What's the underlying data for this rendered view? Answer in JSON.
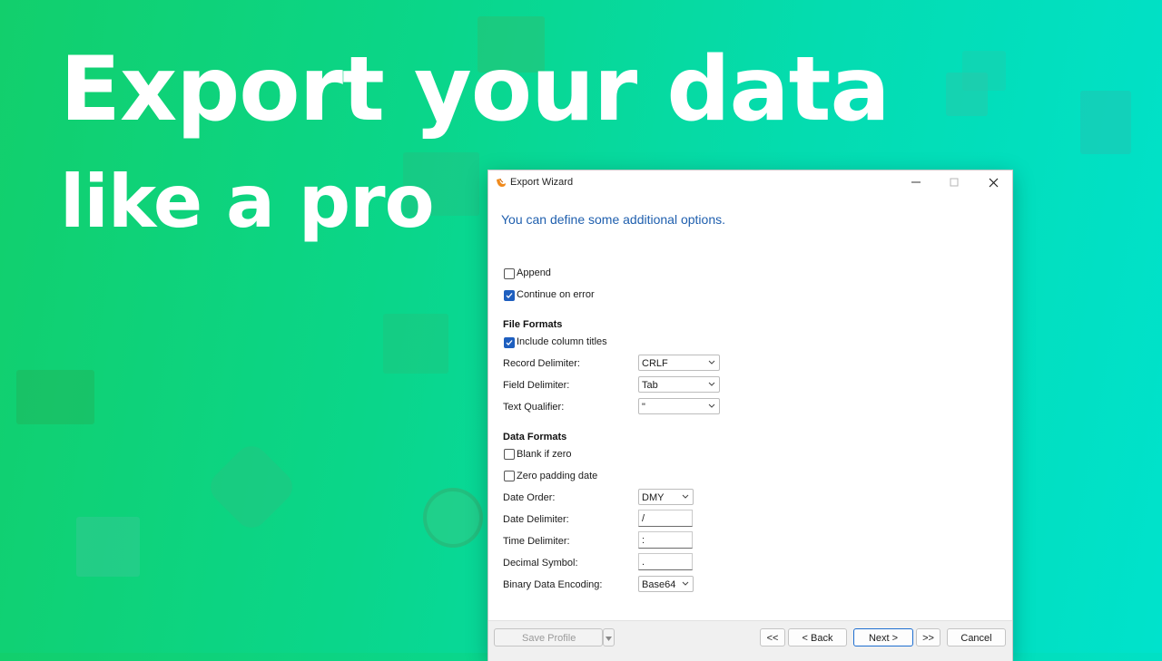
{
  "hero": {
    "line1": "Export your data",
    "line2": "like a pro"
  },
  "window": {
    "title": "Export Wizard",
    "heading": "You can define some additional options.",
    "options": {
      "append": {
        "label": "Append",
        "checked": false
      },
      "continue_on_error": {
        "label": "Continue on error",
        "checked": true
      }
    },
    "file_formats": {
      "title": "File Formats",
      "include_column_titles": {
        "label": "Include column titles",
        "checked": true
      },
      "record_delimiter": {
        "label": "Record Delimiter:",
        "value": "CRLF"
      },
      "field_delimiter": {
        "label": "Field Delimiter:",
        "value": "Tab"
      },
      "text_qualifier": {
        "label": "Text Qualifier:",
        "value": "\""
      }
    },
    "data_formats": {
      "title": "Data Formats",
      "blank_if_zero": {
        "label": "Blank if zero",
        "checked": false
      },
      "zero_padding_date": {
        "label": "Zero padding date",
        "checked": false
      },
      "date_order": {
        "label": "Date Order:",
        "value": "DMY"
      },
      "date_delimiter": {
        "label": "Date Delimiter:",
        "value": "/"
      },
      "time_delimiter": {
        "label": "Time Delimiter:",
        "value": ":"
      },
      "decimal_symbol": {
        "label": "Decimal Symbol:",
        "value": "."
      },
      "binary_encoding": {
        "label": "Binary Data Encoding:",
        "value": "Base64"
      }
    },
    "footer": {
      "save_profile": "Save Profile",
      "first": "<<",
      "back": "< Back",
      "next": "Next >",
      "last": ">>",
      "cancel": "Cancel"
    }
  },
  "colors": {
    "heading": "#1f5fae",
    "checkbox_checked": "#1e5fbf",
    "background_start": "#12cf6c",
    "background_end": "#00e2cc"
  }
}
